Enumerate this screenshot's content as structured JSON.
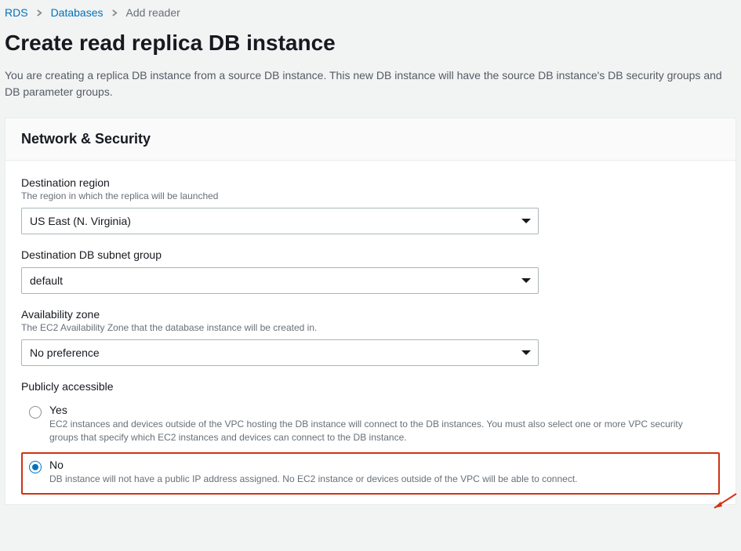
{
  "breadcrumbs": {
    "items": [
      {
        "label": "RDS"
      },
      {
        "label": "Databases"
      },
      {
        "label": "Add reader"
      }
    ]
  },
  "page": {
    "title": "Create read replica DB instance",
    "description": "You are creating a replica DB instance from a source DB instance. This new DB instance will have the source DB instance's DB security groups and DB parameter groups."
  },
  "panel": {
    "title": "Network & Security",
    "fields": {
      "destination_region": {
        "label": "Destination region",
        "hint": "The region in which the replica will be launched",
        "value": "US East (N. Virginia)"
      },
      "subnet_group": {
        "label": "Destination DB subnet group",
        "value": "default"
      },
      "availability_zone": {
        "label": "Availability zone",
        "hint": "The EC2 Availability Zone that the database instance will be created in.",
        "value": "No preference"
      },
      "publicly_accessible": {
        "label": "Publicly accessible",
        "selected": "no",
        "options": {
          "yes": {
            "label": "Yes",
            "description": "EC2 instances and devices outside of the VPC hosting the DB instance will connect to the DB instances. You must also select one or more VPC security groups that specify which EC2 instances and devices can connect to the DB instance."
          },
          "no": {
            "label": "No",
            "description": "DB instance will not have a public IP address assigned. No EC2 instance or devices outside of the VPC will be able to connect."
          }
        }
      }
    }
  },
  "annotation_color": "#d13212"
}
